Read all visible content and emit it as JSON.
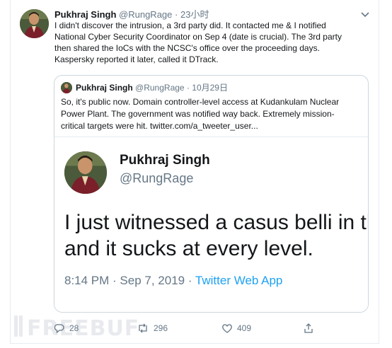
{
  "tweet": {
    "author_name": "Pukhraj Singh",
    "author_handle": "@RungRage",
    "separator": "·",
    "time": "23小时",
    "lines": [
      "I didn't discover the intrusion, a 3rd party did. It contacted me & I notified",
      "National Cyber Security Coordinator on Sep 4 (date is crucial). The 3rd party",
      "then shared the IoCs with the NCSC's office over the proceeding days.",
      "Kaspersky reported it later, called it DTrack."
    ]
  },
  "quoted": {
    "author_name": "Pukhraj Singh",
    "author_handle": "@RungRage",
    "separator": "·",
    "time": "10月29日",
    "lines": [
      "So, it's public now. Domain controller-level access at Kudankulam Nuclear",
      "Power Plant. The government was notified way back. Extremely mission-",
      "critical targets were hit.  twitter.com/a_tweeter_user..."
    ],
    "embedded": {
      "name": "Pukhraj Singh",
      "handle": "@RungRage",
      "line1": "I just witnessed a casus belli in th",
      "line2": "and it sucks at every level.",
      "meta_time": "8:14 PM · Sep 7, 2019 · ",
      "meta_app": "Twitter Web App"
    }
  },
  "actions": {
    "reply_count": "28",
    "retweet_count": "296",
    "like_count": "409"
  },
  "icons": {
    "menu": "chevron-down-icon",
    "reply": "reply-icon",
    "retweet": "retweet-icon",
    "like": "heart-icon",
    "share": "share-icon"
  },
  "watermark": "FREEBUF",
  "colors": {
    "text": "#14171a",
    "secondary": "#657786",
    "link": "#1da1f2",
    "border": "#ccd6dd"
  }
}
